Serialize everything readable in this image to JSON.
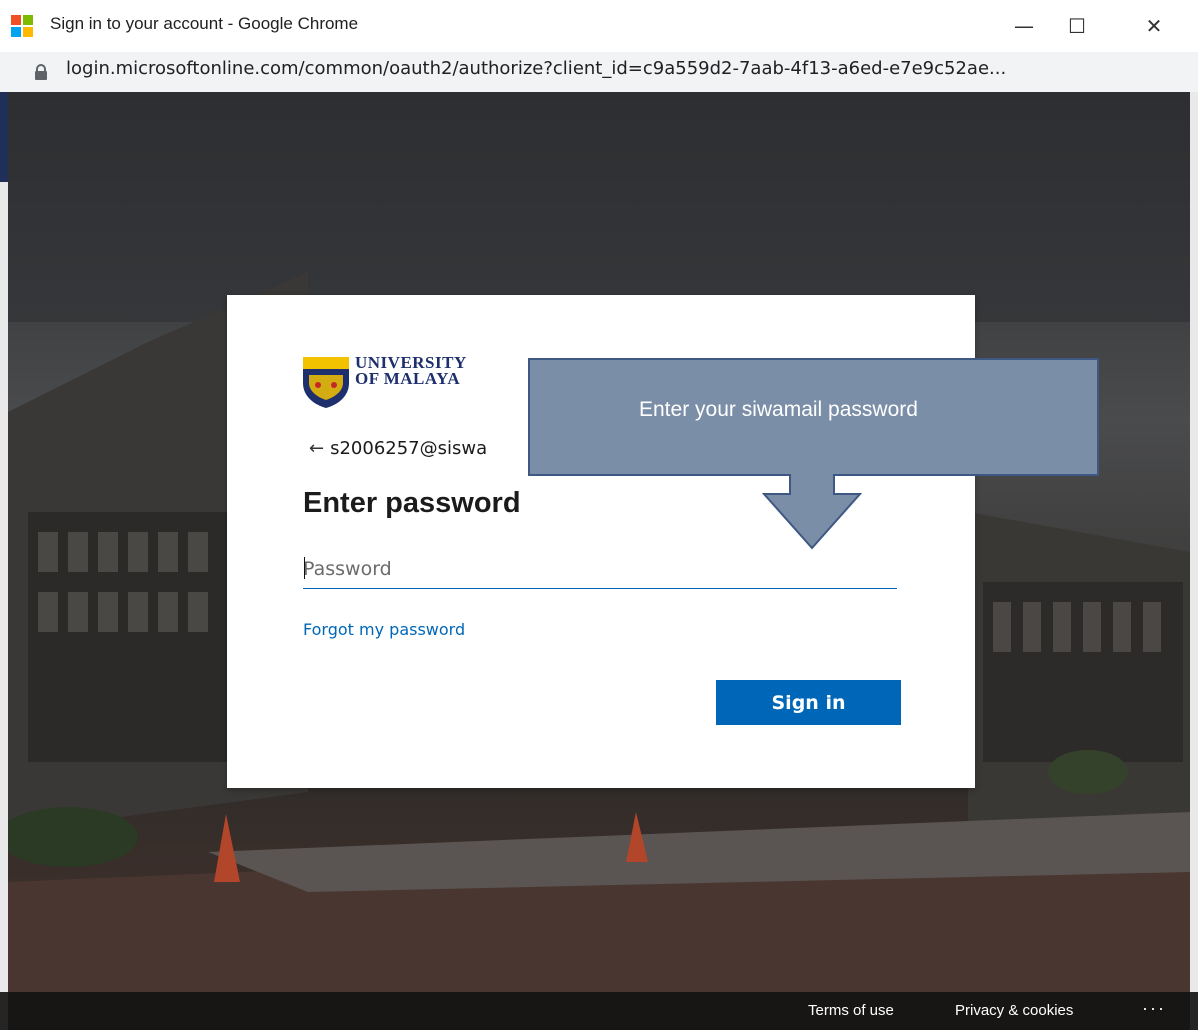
{
  "window": {
    "title": "Sign in to your account - Google Chrome",
    "min_glyph": "—",
    "max_glyph": "☐",
    "close_glyph": "✕",
    "logo_colors": [
      "#f25022",
      "#7fba00",
      "#00a4ef",
      "#ffb900"
    ]
  },
  "address_bar": {
    "url": "login.microsoftonline.com/common/oauth2/authorize?client_id=c9a559d2-7aab-4f13-a6ed-e7e9c52ae..."
  },
  "signin": {
    "logo_line1": "UNIVERSITY",
    "logo_line2": "OF MALAYA",
    "back_arrow": "←",
    "account": "s2006257@siswa",
    "heading": "Enter password",
    "password_placeholder": "Password",
    "forgot_link": "Forgot my password",
    "sign_in_button": "Sign in",
    "accent_color": "#0067b8"
  },
  "callout": {
    "text": "Enter your siwamail password",
    "fill_color": "#7b8ea7",
    "border_color": "#3f5883"
  },
  "footer": {
    "terms": "Terms of use",
    "privacy": "Privacy & cookies",
    "more": "···"
  }
}
